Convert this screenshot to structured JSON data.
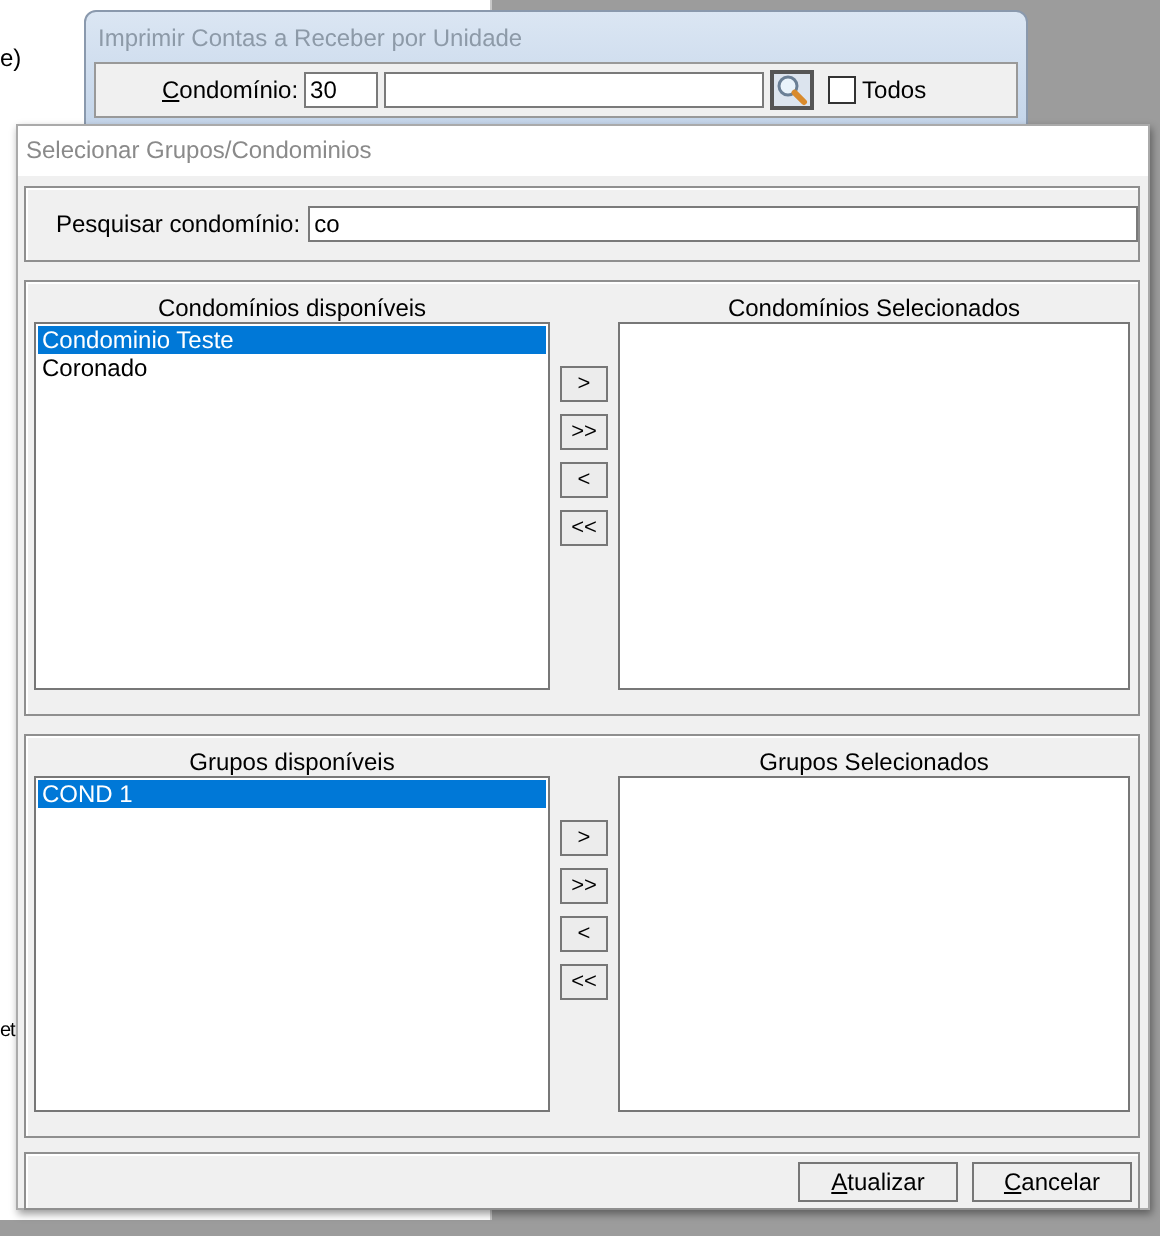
{
  "background_fragments": [
    "e)",
    "et"
  ],
  "back_window": {
    "title": "Imprimir Contas a Receber por Unidade",
    "condominio_label": "Condomínio:",
    "condominio_code": "30",
    "todos": {
      "label": "Todos",
      "checked": false
    }
  },
  "dialog": {
    "title": "Selecionar Grupos/Condominios",
    "search": {
      "label": "Pesquisar condomínio:",
      "value": "co"
    },
    "sections": [
      {
        "available_title": "Condomínios disponíveis",
        "selected_title": "Condomínios Selecionados",
        "available": [
          {
            "label": "Condominio Teste",
            "selected": true
          },
          {
            "label": "Coronado",
            "selected": false
          }
        ],
        "move_buttons": [
          ">",
          ">>",
          "<",
          "<<"
        ]
      },
      {
        "available_title": "Grupos disponíveis",
        "selected_title": "Grupos Selecionados",
        "available": [
          {
            "label": "COND 1",
            "selected": true
          }
        ],
        "move_buttons": [
          ">",
          ">>",
          "<",
          "<<"
        ]
      }
    ],
    "buttons": [
      "Atualizar",
      "Cancelar"
    ]
  }
}
